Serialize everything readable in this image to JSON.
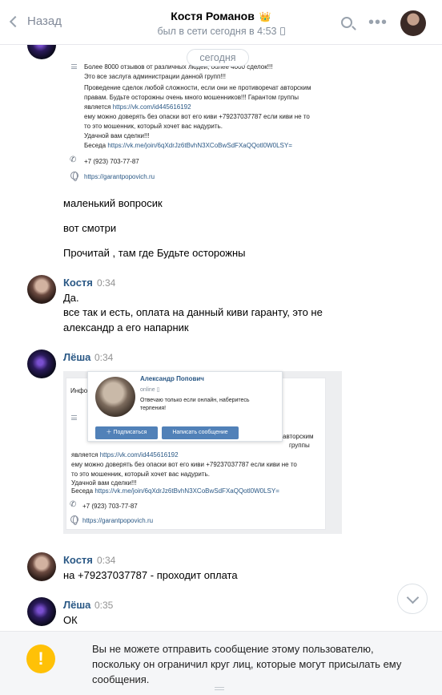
{
  "header": {
    "back_label": "Назад",
    "title": "Костя Романов",
    "title_badge": "👑",
    "status": "был в сети сегодня в 4:53"
  },
  "date_pill": "сегодня",
  "card1": {
    "lines": [
      "Более 8000 отзывов от различных людей, более 4000 сделок!!!",
      "Это все заслуга администрации данной групп!!!",
      "Проведение сделок любой сложности, если они не противоречат авторским",
      "правам. Будьте осторожны очень много мошенников!!! Гарантом группы",
      "является ",
      "ему можно доверять без опаски вот его киви +79237037787 если киви не то",
      "то это мошенник, который хочет вас надурить.",
      "Удачной вам сделки!!!",
      "Беседа "
    ],
    "link_id": "https://vk.com/id445616192",
    "link_chat": "https://vk.me/join/6qXdrJz6tBvhN3XCoBwSdFXaQQotl0W0LSY=",
    "phone": "+7 (923) 703-77-87",
    "site": "https://garantpopovich.ru"
  },
  "messages_top": [
    "маленький вопросик",
    "вот смотри",
    "Прочитай , там где Будьте осторожны"
  ],
  "msg_kostya_1": {
    "author": "Костя",
    "time": "0:34",
    "lines": [
      "Да.",
      "все так и есть, оплата на данный киви гаранту, это не",
      "александр а его напарник"
    ]
  },
  "msg_lesha_1": {
    "author": "Лёша",
    "time": "0:34"
  },
  "screenshot": {
    "tab_fragment": "Инфо",
    "popup": {
      "name": "Александр Попович",
      "online": "online",
      "status": "Отвечаю только если онлайн, наберитесь терпения!",
      "subscribe_button": "Подписаться",
      "message_button": "Написать сообщение"
    },
    "lines": [
      "авторским",
      "группы",
      "является ",
      "ему можно доверять без опаски вот его киви +79237037787 если киви не то",
      "то это мошенник, который хочет вас надурить.",
      "Удачной вам сделки!!!",
      "Беседа "
    ],
    "link_id": "https://vk.com/id445616192",
    "link_chat": "https://vk.me/join/6qXdrJz6tBvhN3XCoBwSdFXaQQotl0W0LSY=",
    "phone": "+7 (923) 703-77-87",
    "site": "https://garantpopovich.ru"
  },
  "msg_kostya_2": {
    "author": "Костя",
    "time": "0:34",
    "text": "на +79237037787 - проходит оплата"
  },
  "msg_lesha_2": {
    "author": "Лёша",
    "time": "0:35",
    "text": "ОК"
  },
  "notice": {
    "text": "Вы не можете отправить сообщение этому пользователю, поскольку он ограничил круг лиц, которые могут присылать ему сообщения."
  },
  "colors": {
    "link": "#2a5885",
    "accent_button": "#5181b8",
    "warning": "#ffc107"
  }
}
